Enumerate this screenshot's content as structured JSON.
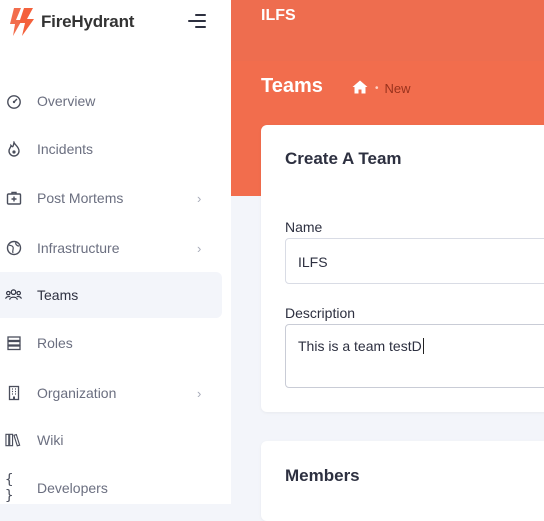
{
  "brand": {
    "name": "FireHydrant",
    "accent": "#f26d4d"
  },
  "sidebar": {
    "items": [
      {
        "label": "Overview",
        "icon": "dashboard-gauge-icon",
        "chevron": false,
        "active": false
      },
      {
        "label": "Incidents",
        "icon": "fire-icon",
        "chevron": false,
        "active": false
      },
      {
        "label": "Post Mortems",
        "icon": "medical-kit-icon",
        "chevron": true,
        "active": false
      },
      {
        "label": "Infrastructure",
        "icon": "globe-icon",
        "chevron": true,
        "active": false
      },
      {
        "label": "Teams",
        "icon": "users-icon",
        "chevron": false,
        "active": true
      },
      {
        "label": "Roles",
        "icon": "server-stack-icon",
        "chevron": false,
        "active": false
      },
      {
        "label": "Organization",
        "icon": "building-icon",
        "chevron": true,
        "active": false
      },
      {
        "label": "Wiki",
        "icon": "books-icon",
        "chevron": false,
        "active": false
      },
      {
        "label": "Developers",
        "icon": "code-braces-icon",
        "chevron": false,
        "active": false
      }
    ]
  },
  "header": {
    "org_name": "ILFS",
    "page_title": "Teams",
    "breadcrumb_current": "New"
  },
  "form": {
    "title": "Create A Team",
    "name_label": "Name",
    "name_value": "ILFS",
    "description_label": "Description",
    "description_value": "This is a team testD"
  },
  "members": {
    "title": "Members"
  }
}
